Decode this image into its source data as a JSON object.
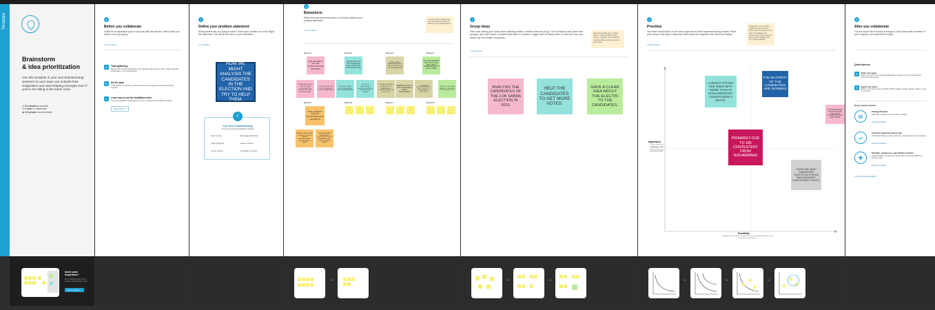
{
  "colors": {
    "accent": "#1ea1d2",
    "pink": "#f6b8cd",
    "teal": "#93e3dc",
    "lime": "#b9eb9c",
    "yellow": "#f8f075",
    "orange": "#f8c16a",
    "blue": "#2264a9",
    "magenta": "#c8175b",
    "gray": "#d1d1d1"
  },
  "tag": "Template",
  "intro": {
    "title_line1": "Brainstorm",
    "title_line2": "& idea prioritization",
    "desc": "Use this template in your own brainstorming sessions so your team can unleash their imagination and start shaping concepts even if you're not sitting in the same room.",
    "meta": [
      {
        "bold": "10 minutes",
        "rest": " to prepare"
      },
      {
        "bold": "1 hour",
        "rest": " to collaborate"
      },
      {
        "bold": "2-8 people",
        "rest": " recommended"
      }
    ]
  },
  "before": {
    "step": "A",
    "title": "Before you collaborate",
    "desc": "A little bit of preparation goes a long way with this session. Here's what you need to do to get going.",
    "time": "10 minutes",
    "items": [
      {
        "n": "A",
        "title": "Team gathering",
        "text": "Define who should participate in the session and send an invite. Share relevant information or pre-work ahead."
      },
      {
        "n": "B",
        "title": "Set the goal",
        "text": "Think about the problem you'll be focusing on solving in the brainstorming session."
      },
      {
        "n": "C",
        "title": "Learn how to use the facilitation tools",
        "text": "Use the Facilitation Superpowers to run a happy and productive session."
      }
    ],
    "open_article": "Open article"
  },
  "define": {
    "step": "1",
    "title": "Define your problem statement",
    "desc": "What problem are you trying to solve? Frame your problem as a How Might We statement. This will be the focus of your brainstorm.",
    "time": "5 minutes",
    "statement": "HOW WE MIGHT ANALYSIS THE CANDIDATES IN THE ELECTION AND TRY TO HELP THEM.",
    "rules_title": "Key rules of brainstorming",
    "rules_sub": "To run an smooth and productive session",
    "rules": [
      "Stay in topic.",
      "Encourage wild ideas.",
      "Defer judgment.",
      "Listen to others.",
      "Go for volume.",
      "If possible, be visual."
    ]
  },
  "brainstorm": {
    "step": "2",
    "title": "Brainstorm",
    "desc": "Write down any ideas that come to mind that address your problem statement.",
    "time": "10 minutes",
    "tip": "You can select a sticky note and hit the pencil (switch to sketch) icon to start drawing!",
    "persons": [
      "Person 1",
      "Person 2",
      "Person 3",
      "Person 4",
      "Person 5",
      "Person 6",
      "Person 7",
      "Person 8"
    ],
    "p1": [
      "THE MAJORITY OF THE CANDIDATE ARE WOMENS",
      "WOMEN IN ALL AGE GROUPS HAVE VOTED AND THE HIGHEST TURNOUT AMONGST MEN",
      "VOTER TURNOUT IN CONSTITUENCIES FOR SC CANDIDATES"
    ],
    "p2": [
      "THE MAJORITY OF THE CANDIDATES ARE CONTESTING FOR SECOND TIME",
      "WE SEE WOMEN ELECTORS HAVING OUTNUMBERED MEN",
      "OUT OF 8 CANDIDATES SHORTLISTED MORE THAN SIX ARE WOMEN"
    ],
    "p3": [
      "MORE THAN 2 CANDIDATES HAVE BEEN CONTESTING FOR THE SAME SEAT",
      "OUT HAS THE THIRD HIGHEST NO OF CANDIDATES CONTESTING IN THE ELECTION",
      "PRIMARILY DUE TO 185 CONTESTENT FROM NIZHAMABAD",
      "TELANGANA ELECTION RESULT AND NUMBER OF CANDIDATES"
    ],
    "p4": [
      "IN UTTAR PRADESH THE TWO STATES THEY ARE IN COMPETITION WITH EACH OTHER",
      "THE HIGHEST NUMBER OF CANDIDATES CONTESTED IN THE SEAT",
      "THE MOST NATIONAL PARTIES CONTESTED IN THIS ELECTION"
    ],
    "p5": [
      "THE LARGEST STATES TOGETHER HAVE 239 SEATS",
      "LARGEST STATES ARE ONES WITH MORE THAN 20 PARLIAMENTARY CONSTITUENCY SEATS",
      "THERE ARE BEEN CANDIDATES CONTISTING FOR 543 PARLIAMENTARY CONSTITUENCY SEATS"
    ]
  },
  "group": {
    "step": "3",
    "title": "Group ideas",
    "desc": "Take turns sharing your ideas while clustering similar or related notes as you go. Once all sticky notes have been grouped, give each cluster a sentence-like label. If a cluster is bigger than six sticky notes, try and see if you can break it up into smaller sub-groups.",
    "time": "20 minutes",
    "tip": "Add customizable tags to sticky notes to make it easier to find, browse, organize, and categorize important ideas as themes within your mural.",
    "notes": [
      "ANALYSIS THE CANDIDATES OF THE LOK SABHA ELECTION IN 2019.",
      "HELP THE CANDIDATES TO GET MORE VOTES.",
      "GAVE A CLEAR IDEA ABOUT THE ELECTIN TO THE CANDIDATES."
    ]
  },
  "prioritize": {
    "step": "4",
    "title": "Prioritize",
    "desc": "Your team should all be on the same page about what's important moving forward. Place your ideas on this grid to determine which ideas are important and which are feasible.",
    "time": "20 minutes",
    "tip": "Participants can use their cursors to point at where sticky notes should go on the grid. The facilitator can confirm the spot by using the laser pointer holding the H key on the keyboard.",
    "y_label": "Importance",
    "y_desc": "If each of these tasks could get done without any difficulty or cost, which would have the most positive impact?",
    "x_label": "Feasibility",
    "x_desc": "Regardless of their importance, which tasks are more feasible than others? (Cost, time, effort, complexity, etc.)",
    "notes": [
      "LARGEST STATES ARE ONES WITH MORE THAN 20 PARLIAMENTARY CONSTITUENCY SEATS.",
      "THE MAJORITY OF THE CANDIDATES ARE WOMENS",
      "IN UTTAR PRADESH THE TWO STATES THEY ARE IN COMPETITION WITH EACH OTHER",
      "PRIMARILY DUE TO 185 CONTESTENT FROM NIZHAMABAD",
      "THERE ARE BEEN CANDIDATES CONTISTING FOR 543 PARLIAMENTARY CONSTITUENCY SEATS."
    ]
  },
  "after": {
    "step": "B",
    "title": "After you collaborate",
    "desc": "You can export the mural as an image or pdf to share with members of your company who might find it helpful.",
    "quick_title": "Quick add-ons",
    "quick": [
      {
        "n": "A",
        "title": "Share the mural",
        "text": "Share a view link to the mural with stakeholders to keep them in the loop about the outcomes of the session."
      },
      {
        "n": "B",
        "title": "Export the mural",
        "text": "Export a copy of the mural as a PNG or PDF to attach to emails, include in slides, or save in your drive."
      }
    ],
    "keep_title": "Keep moving forward",
    "keep": [
      {
        "title": "Strategy blueprint",
        "text": "Define the components of a new idea or strategy.",
        "link": "Open the template"
      },
      {
        "title": "Customer experience journey map",
        "text": "Understand customer needs, motivations, and obstacles for an experience.",
        "link": "Open the template"
      },
      {
        "title": "Strengths, weaknesses, opportunities & threats",
        "text": "Identify strengths, weaknesses, opportunities, and threats (SWOT) to develop a plan.",
        "link": "Open the template"
      }
    ],
    "feedback": "Share template feedback"
  },
  "inspiration": {
    "title": "Need some inspiration?",
    "text": "See a finished version of this template to kickstart your work.",
    "button": "Open example"
  }
}
